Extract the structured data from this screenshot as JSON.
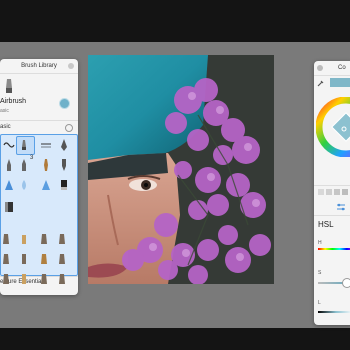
{
  "brush_library": {
    "title": "Brush Library",
    "current_brush": "Airbrush",
    "current_brush_set": "asic",
    "section_basic": "asic",
    "section_texture": "exture Essentials",
    "tools_row1": [
      "∼",
      "⟋",
      "",
      ""
    ],
    "tools_row2": [
      "",
      "3",
      "",
      ""
    ],
    "tools_row3": [
      "",
      "",
      "",
      ""
    ],
    "badge_count": "3"
  },
  "color_panel": {
    "title": "Co",
    "mode_label": "HSL",
    "h_label": "H",
    "s_label": "S",
    "l_label": "L",
    "accent_color": "#7fb7c8"
  }
}
